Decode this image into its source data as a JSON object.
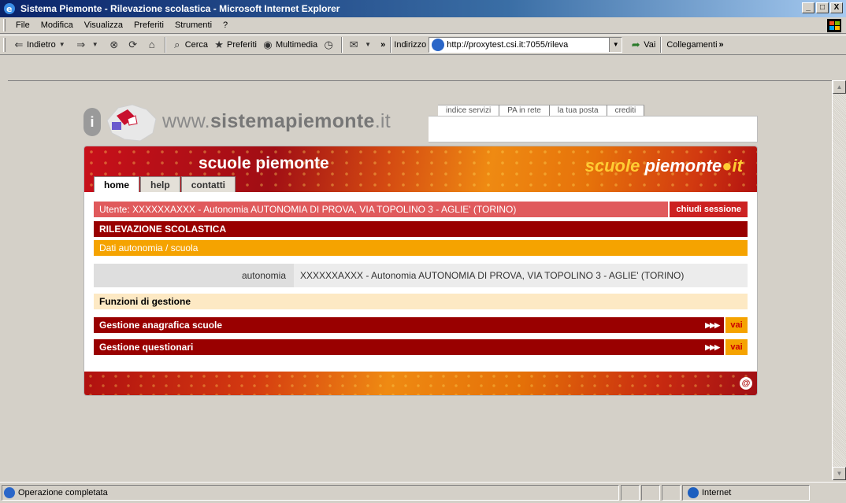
{
  "window": {
    "title": "Sistema Piemonte - Rilevazione scolastica - Microsoft Internet Explorer",
    "btn_min": "_",
    "btn_max": "□",
    "btn_close": "X"
  },
  "menu": [
    "File",
    "Modifica",
    "Visualizza",
    "Preferiti",
    "Strumenti",
    "?"
  ],
  "toolbar": {
    "back": "Indietro",
    "search": "Cerca",
    "favorites": "Preferiti",
    "media": "Multimedia",
    "chevron": "»",
    "address_label": "Indirizzo",
    "address_value": "http://proxytest.csi.it:7055/rileva",
    "go": "Vai",
    "links": "Collegamenti",
    "links_chevron": "»"
  },
  "portal": {
    "site_prefix": "www.",
    "site_bold": "sistemapiemonte",
    "site_suffix": ".it",
    "links": [
      "indice servizi",
      "PA in rete",
      "la tua posta",
      "crediti"
    ]
  },
  "banner": {
    "title": "scuole piemonte",
    "brand_a": "scuole ",
    "brand_b": "piemonte",
    "brand_c": "it"
  },
  "tabs": [
    "home",
    "help",
    "contatti"
  ],
  "user_row": {
    "text": "Utente: XXXXXXAXXX - Autonomia AUTONOMIA DI PROVA, VIA TOPOLINO 3 - AGLIE' (TORINO)",
    "close": "chiudi sessione"
  },
  "section_title": "RILEVAZIONE SCOLASTICA",
  "sub_title": "Dati autonomia / scuola",
  "data_row": {
    "label": "autonomia",
    "value": "XXXXXXAXXX - Autonomia AUTONOMIA DI PROVA, VIA TOPOLINO 3 - AGLIE' (TORINO)"
  },
  "functions_title": "Funzioni di gestione",
  "function_links": [
    {
      "label": "Gestione anagrafica scuole",
      "arrows": "▶▶▶",
      "go": "vai"
    },
    {
      "label": "Gestione questionari",
      "arrows": "▶▶▶",
      "go": "vai"
    }
  ],
  "status": {
    "text": "Operazione completata",
    "zone": "Internet"
  },
  "colors": {
    "titlebar": "#0a246a",
    "dark_red": "#990000",
    "orange": "#f5a300",
    "user_row": "#e05a5c",
    "functions_bg": "#fde9c4"
  }
}
